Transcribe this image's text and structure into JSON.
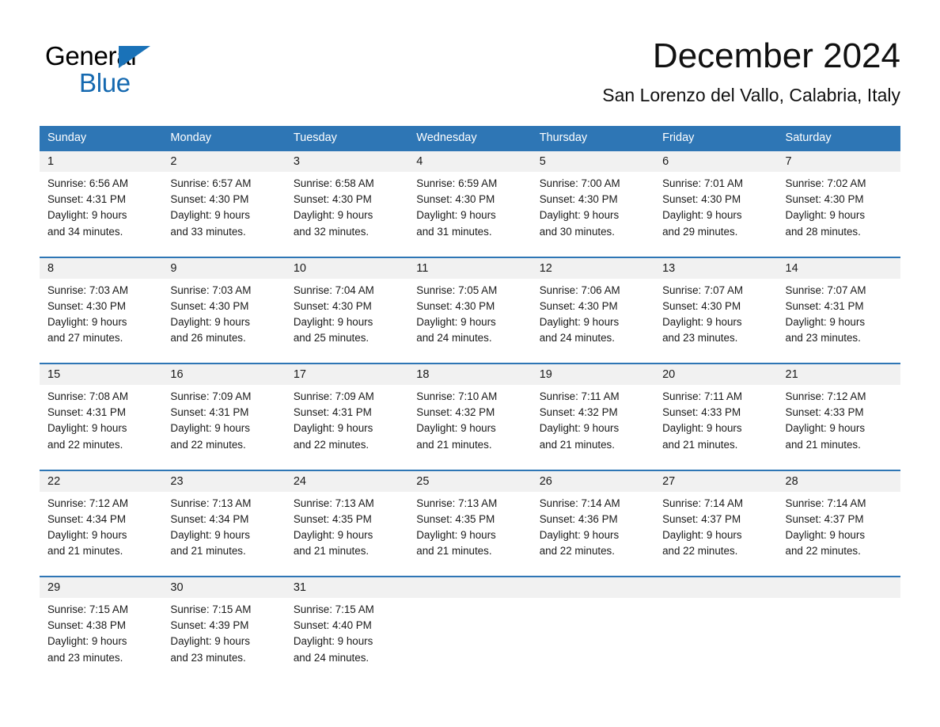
{
  "brand": {
    "name_part1": "General",
    "name_part2": "Blue",
    "triangle_color": "#1a72b8",
    "text_color": "#000000",
    "blue_text_color": "#1569b0"
  },
  "header": {
    "month_title": "December 2024",
    "location": "San Lorenzo del Vallo, Calabria, Italy"
  },
  "theme": {
    "header_blue": "#2e76b5",
    "daynum_band": "#f1f1f1",
    "separator_blue": "#2e76b5",
    "text": "#1a1a1a"
  },
  "weekdays": [
    "Sunday",
    "Monday",
    "Tuesday",
    "Wednesday",
    "Thursday",
    "Friday",
    "Saturday"
  ],
  "weeks": [
    [
      {
        "day": "1",
        "sunrise": "Sunrise: 6:56 AM",
        "sunset": "Sunset: 4:31 PM",
        "daylight_1": "Daylight: 9 hours",
        "daylight_2": "and 34 minutes."
      },
      {
        "day": "2",
        "sunrise": "Sunrise: 6:57 AM",
        "sunset": "Sunset: 4:30 PM",
        "daylight_1": "Daylight: 9 hours",
        "daylight_2": "and 33 minutes."
      },
      {
        "day": "3",
        "sunrise": "Sunrise: 6:58 AM",
        "sunset": "Sunset: 4:30 PM",
        "daylight_1": "Daylight: 9 hours",
        "daylight_2": "and 32 minutes."
      },
      {
        "day": "4",
        "sunrise": "Sunrise: 6:59 AM",
        "sunset": "Sunset: 4:30 PM",
        "daylight_1": "Daylight: 9 hours",
        "daylight_2": "and 31 minutes."
      },
      {
        "day": "5",
        "sunrise": "Sunrise: 7:00 AM",
        "sunset": "Sunset: 4:30 PM",
        "daylight_1": "Daylight: 9 hours",
        "daylight_2": "and 30 minutes."
      },
      {
        "day": "6",
        "sunrise": "Sunrise: 7:01 AM",
        "sunset": "Sunset: 4:30 PM",
        "daylight_1": "Daylight: 9 hours",
        "daylight_2": "and 29 minutes."
      },
      {
        "day": "7",
        "sunrise": "Sunrise: 7:02 AM",
        "sunset": "Sunset: 4:30 PM",
        "daylight_1": "Daylight: 9 hours",
        "daylight_2": "and 28 minutes."
      }
    ],
    [
      {
        "day": "8",
        "sunrise": "Sunrise: 7:03 AM",
        "sunset": "Sunset: 4:30 PM",
        "daylight_1": "Daylight: 9 hours",
        "daylight_2": "and 27 minutes."
      },
      {
        "day": "9",
        "sunrise": "Sunrise: 7:03 AM",
        "sunset": "Sunset: 4:30 PM",
        "daylight_1": "Daylight: 9 hours",
        "daylight_2": "and 26 minutes."
      },
      {
        "day": "10",
        "sunrise": "Sunrise: 7:04 AM",
        "sunset": "Sunset: 4:30 PM",
        "daylight_1": "Daylight: 9 hours",
        "daylight_2": "and 25 minutes."
      },
      {
        "day": "11",
        "sunrise": "Sunrise: 7:05 AM",
        "sunset": "Sunset: 4:30 PM",
        "daylight_1": "Daylight: 9 hours",
        "daylight_2": "and 24 minutes."
      },
      {
        "day": "12",
        "sunrise": "Sunrise: 7:06 AM",
        "sunset": "Sunset: 4:30 PM",
        "daylight_1": "Daylight: 9 hours",
        "daylight_2": "and 24 minutes."
      },
      {
        "day": "13",
        "sunrise": "Sunrise: 7:07 AM",
        "sunset": "Sunset: 4:30 PM",
        "daylight_1": "Daylight: 9 hours",
        "daylight_2": "and 23 minutes."
      },
      {
        "day": "14",
        "sunrise": "Sunrise: 7:07 AM",
        "sunset": "Sunset: 4:31 PM",
        "daylight_1": "Daylight: 9 hours",
        "daylight_2": "and 23 minutes."
      }
    ],
    [
      {
        "day": "15",
        "sunrise": "Sunrise: 7:08 AM",
        "sunset": "Sunset: 4:31 PM",
        "daylight_1": "Daylight: 9 hours",
        "daylight_2": "and 22 minutes."
      },
      {
        "day": "16",
        "sunrise": "Sunrise: 7:09 AM",
        "sunset": "Sunset: 4:31 PM",
        "daylight_1": "Daylight: 9 hours",
        "daylight_2": "and 22 minutes."
      },
      {
        "day": "17",
        "sunrise": "Sunrise: 7:09 AM",
        "sunset": "Sunset: 4:31 PM",
        "daylight_1": "Daylight: 9 hours",
        "daylight_2": "and 22 minutes."
      },
      {
        "day": "18",
        "sunrise": "Sunrise: 7:10 AM",
        "sunset": "Sunset: 4:32 PM",
        "daylight_1": "Daylight: 9 hours",
        "daylight_2": "and 21 minutes."
      },
      {
        "day": "19",
        "sunrise": "Sunrise: 7:11 AM",
        "sunset": "Sunset: 4:32 PM",
        "daylight_1": "Daylight: 9 hours",
        "daylight_2": "and 21 minutes."
      },
      {
        "day": "20",
        "sunrise": "Sunrise: 7:11 AM",
        "sunset": "Sunset: 4:33 PM",
        "daylight_1": "Daylight: 9 hours",
        "daylight_2": "and 21 minutes."
      },
      {
        "day": "21",
        "sunrise": "Sunrise: 7:12 AM",
        "sunset": "Sunset: 4:33 PM",
        "daylight_1": "Daylight: 9 hours",
        "daylight_2": "and 21 minutes."
      }
    ],
    [
      {
        "day": "22",
        "sunrise": "Sunrise: 7:12 AM",
        "sunset": "Sunset: 4:34 PM",
        "daylight_1": "Daylight: 9 hours",
        "daylight_2": "and 21 minutes."
      },
      {
        "day": "23",
        "sunrise": "Sunrise: 7:13 AM",
        "sunset": "Sunset: 4:34 PM",
        "daylight_1": "Daylight: 9 hours",
        "daylight_2": "and 21 minutes."
      },
      {
        "day": "24",
        "sunrise": "Sunrise: 7:13 AM",
        "sunset": "Sunset: 4:35 PM",
        "daylight_1": "Daylight: 9 hours",
        "daylight_2": "and 21 minutes."
      },
      {
        "day": "25",
        "sunrise": "Sunrise: 7:13 AM",
        "sunset": "Sunset: 4:35 PM",
        "daylight_1": "Daylight: 9 hours",
        "daylight_2": "and 21 minutes."
      },
      {
        "day": "26",
        "sunrise": "Sunrise: 7:14 AM",
        "sunset": "Sunset: 4:36 PM",
        "daylight_1": "Daylight: 9 hours",
        "daylight_2": "and 22 minutes."
      },
      {
        "day": "27",
        "sunrise": "Sunrise: 7:14 AM",
        "sunset": "Sunset: 4:37 PM",
        "daylight_1": "Daylight: 9 hours",
        "daylight_2": "and 22 minutes."
      },
      {
        "day": "28",
        "sunrise": "Sunrise: 7:14 AM",
        "sunset": "Sunset: 4:37 PM",
        "daylight_1": "Daylight: 9 hours",
        "daylight_2": "and 22 minutes."
      }
    ],
    [
      {
        "day": "29",
        "sunrise": "Sunrise: 7:15 AM",
        "sunset": "Sunset: 4:38 PM",
        "daylight_1": "Daylight: 9 hours",
        "daylight_2": "and 23 minutes."
      },
      {
        "day": "30",
        "sunrise": "Sunrise: 7:15 AM",
        "sunset": "Sunset: 4:39 PM",
        "daylight_1": "Daylight: 9 hours",
        "daylight_2": "and 23 minutes."
      },
      {
        "day": "31",
        "sunrise": "Sunrise: 7:15 AM",
        "sunset": "Sunset: 4:40 PM",
        "daylight_1": "Daylight: 9 hours",
        "daylight_2": "and 24 minutes."
      },
      {
        "day": "",
        "sunrise": "",
        "sunset": "",
        "daylight_1": "",
        "daylight_2": ""
      },
      {
        "day": "",
        "sunrise": "",
        "sunset": "",
        "daylight_1": "",
        "daylight_2": ""
      },
      {
        "day": "",
        "sunrise": "",
        "sunset": "",
        "daylight_1": "",
        "daylight_2": ""
      },
      {
        "day": "",
        "sunrise": "",
        "sunset": "",
        "daylight_1": "",
        "daylight_2": ""
      }
    ]
  ]
}
